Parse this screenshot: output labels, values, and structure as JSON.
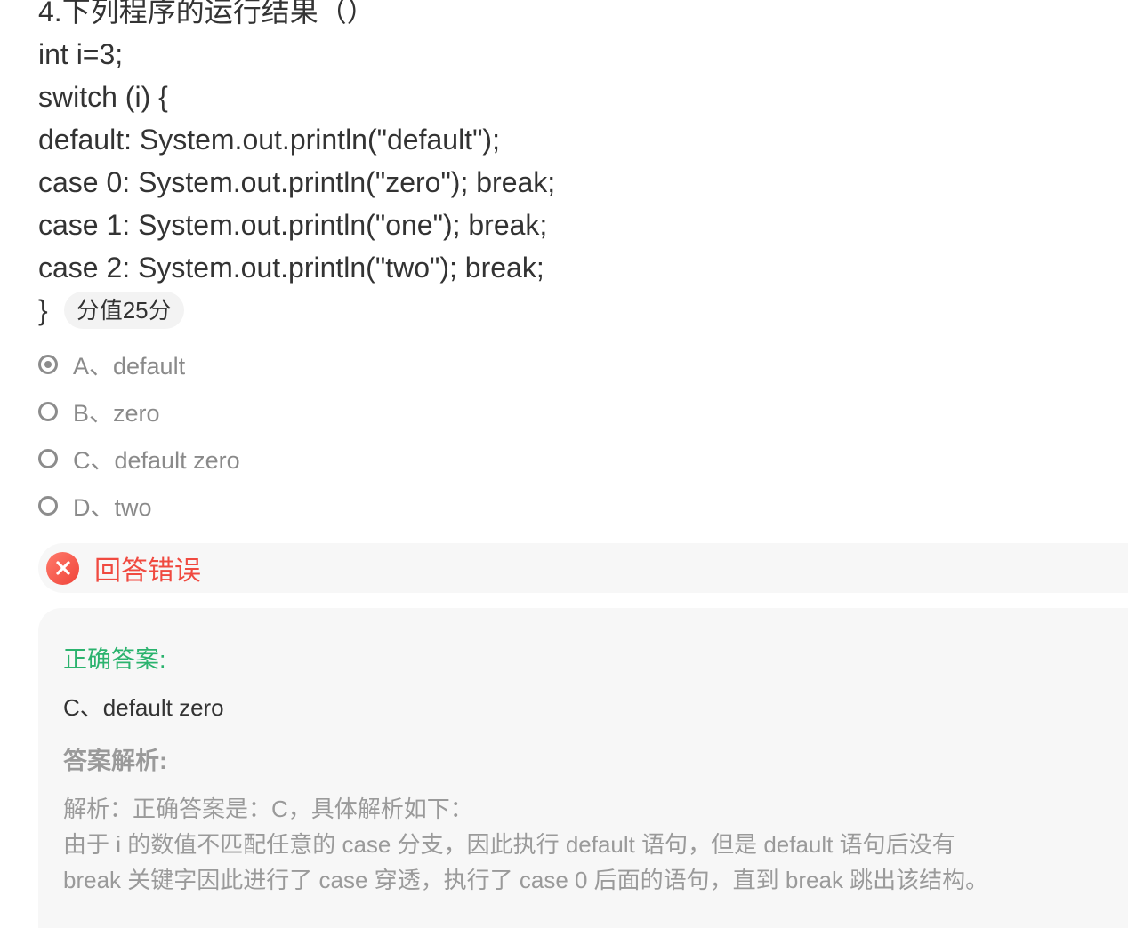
{
  "question": {
    "lines": [
      "4.下列程序的运行结果（）",
      "int i=3;",
      "switch (i) {",
      "default: System.out.println(\"default\");",
      "case 0: System.out.println(\"zero\"); break;",
      "case 1: System.out.println(\"one\"); break;",
      "case 2: System.out.println(\"two\"); break;",
      "}"
    ],
    "score": "分值25分"
  },
  "options": [
    {
      "label": "A、default",
      "selected": true
    },
    {
      "label": "B、zero",
      "selected": false
    },
    {
      "label": "C、default zero",
      "selected": false
    },
    {
      "label": "D、two",
      "selected": false
    }
  ],
  "result": {
    "text": "回答错误",
    "icon": "close-icon",
    "color": "#f04a40"
  },
  "answer": {
    "correct_title": "正确答案:",
    "correct_value": "C、default zero",
    "analysis_title": "答案解析:",
    "analysis_lines": [
      "解析：正确答案是：C，具体解析如下：",
      "由于 i 的数值不匹配任意的 case 分支，因此执行 default 语句，但是 default 语句后没有",
      "break 关键字因此进行了 case 穿透，执行了 case 0 后面的语句，直到 break 跳出该结构。"
    ]
  },
  "colors": {
    "correct": "#2bb36e",
    "muted": "#9a9a9a",
    "text": "#333333"
  }
}
